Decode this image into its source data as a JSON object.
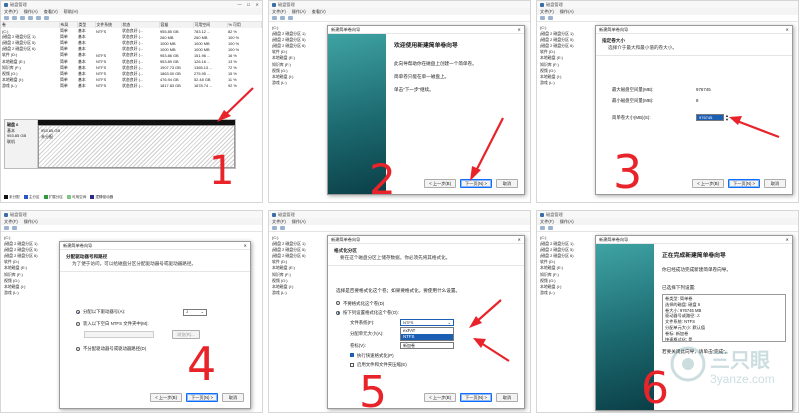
{
  "app_title": "磁盘管理",
  "menu": [
    "文件(F)",
    "操作(A)",
    "查看(V)",
    "帮助(H)"
  ],
  "table": {
    "headers": [
      "卷",
      "布局",
      "类型",
      "文件系统",
      "状态",
      "容量",
      "可用空间",
      "% 可用"
    ],
    "rows": [
      [
        "(C:)",
        "简单",
        "基本",
        "NTFS",
        "状态良好 (...",
        "955.85 GB",
        "783.12 ...",
        "82 %"
      ],
      [
        "(磁盘 2 磁盘分区 1)",
        "简单",
        "基本",
        "",
        "状态良好 (...",
        "260 MB",
        "260 MB",
        "100 %"
      ],
      [
        "(磁盘 2 磁盘分区 5)",
        "简单",
        "基本",
        "",
        "状态良好 (...",
        "1000 MB",
        "1000 MB",
        "100 %"
      ],
      [
        "(磁盘 2 磁盘分区 6)",
        "简单",
        "基本",
        "",
        "状态良好 (...",
        "1000 MB",
        "1000 MB",
        "100 %"
      ],
      [
        "软件 (D:)",
        "简单",
        "基本",
        "NTFS",
        "状态良好 (...",
        "953.86 GB",
        "151.96 ...",
        "16 %"
      ],
      [
        "本地磁盘 (E:)",
        "简单",
        "基本",
        "NTFS",
        "状态良好 (...",
        "953.89 GB",
        "126.16 ...",
        "13 %"
      ],
      [
        "知识库 (F:)",
        "简单",
        "基本",
        "NTFS",
        "状态良好 (...",
        "1907.73 GB",
        "1365.13 ...",
        "72 %"
      ],
      [
        "视频 (G:)",
        "简单",
        "基本",
        "NTFS",
        "状态良好 (...",
        "1863.00 GB",
        "275.95 ...",
        "15 %"
      ],
      [
        "本地磁盘 (I:)",
        "简单",
        "基本",
        "NTFS",
        "状态良好 (...",
        "476.94 GB",
        "52.48 GB",
        "11 %"
      ],
      [
        "游戏 (L:)",
        "简单",
        "基本",
        "NTFS",
        "状态良好 (...",
        "1817.83 GB",
        "1678.74 ...",
        "92 %"
      ]
    ]
  },
  "tree_short": [
    "(C:)",
    "(磁盘 2 磁盘分区 1)",
    "(磁盘 2 磁盘分区 5)",
    "(磁盘 2 磁盘分区 6)",
    "软件 (D:)",
    "本地磁盘 (E:)",
    "知识库 (F:)",
    "视频 (G:)",
    "本地磁盘 (I:)",
    "游戏 (L:)"
  ],
  "disk": {
    "name": "磁盘 6",
    "type": "基本",
    "size": "953.85 GB",
    "status": "联机",
    "part_size": "953.85 GB",
    "part_label": "未分配"
  },
  "legend": [
    "未分配",
    "主分区",
    "扩展分区",
    "可用空间",
    "逻辑驱动器"
  ],
  "wizard_title": "新建简单卷向导",
  "step1": {
    "number": "1"
  },
  "step2": {
    "heading": "欢迎使用新建简单卷向导",
    "lines": [
      "此向导帮助你在磁盘上创建一个简单卷。",
      "简单卷只能在单一磁盘上。",
      "单击“下一步”继续。"
    ],
    "back": "< 上一步(B)",
    "next": "下一页(N) >",
    "cancel": "取消",
    "number": "2"
  },
  "step3": {
    "heading": "指定卷大小",
    "sub": "选择介于最大和最小值的卷大小。",
    "max_label": "最大磁盘空间量(MB):",
    "max_val": "976745",
    "min_label": "最小磁盘空间量(MB):",
    "min_val": "8",
    "size_label": "简单卷大小(MB)(S):",
    "size_val": "976745",
    "back": "< 上一步(B)",
    "next": "下一页(N) >",
    "cancel": "取消",
    "number": "3"
  },
  "step4": {
    "heading": "分配驱动器号和路径",
    "sub": "为了便于访问，可以给磁盘分区分配驱动器号或驱动器路径。",
    "opt1": "分配以下驱动器号(A):",
    "opt1_val": "J",
    "opt2": "装入以下空白 NTFS 文件夹中(M):",
    "browse": "浏览(R)...",
    "opt3": "不分配驱动器号或驱动器路径(D)",
    "back": "< 上一步(B)",
    "next": "下一页(N) >",
    "cancel": "取消",
    "number": "4"
  },
  "step5": {
    "heading": "格式化分区",
    "sub": "要在这个磁盘分区上储存数据，你必须先将其格式化。",
    "intro": "选择是否要格式化这个卷；如果要格式化，要使用什么设置。",
    "opt1": "不要格式化这个卷(D)",
    "opt2": "按下列设置格式化这个卷(O):",
    "fs_label": "文件系统(F):",
    "fs_val": "NTFS",
    "fs_options": [
      "exFAT",
      "NTFS"
    ],
    "au_label": "分配单元大小(A):",
    "au_val": "默认值",
    "vl_label": "卷标(V):",
    "vl_val": "新加卷",
    "quick": "执行快速格式化(P)",
    "compress": "启用文件和文件夹压缩(E)",
    "back": "< 上一步(B)",
    "next": "下一页(N) >",
    "cancel": "取消",
    "number": "5"
  },
  "step6": {
    "heading": "正在完成新建简单卷向导",
    "line1": "你已经成功完成新建简单卷向导。",
    "line2": "已选择下列设置:",
    "settings": [
      "卷类型: 简单卷",
      "选择的磁盘: 磁盘 6",
      "卷大小: 976745 MB",
      "驱动器号或路径: J:",
      "文件系统: NTFS",
      "分配单元大小: 默认值",
      "卷标: 新加卷",
      "快速格式化: 是"
    ],
    "line3": "若要关闭此向导，请单击“完成”。",
    "number": "6"
  },
  "watermark": {
    "brand": "三只眼",
    "url": "3yanze.com"
  },
  "colors": {
    "accent": "#e8232a",
    "teal": "#1c6a70",
    "selection": "#1a5fb4"
  }
}
